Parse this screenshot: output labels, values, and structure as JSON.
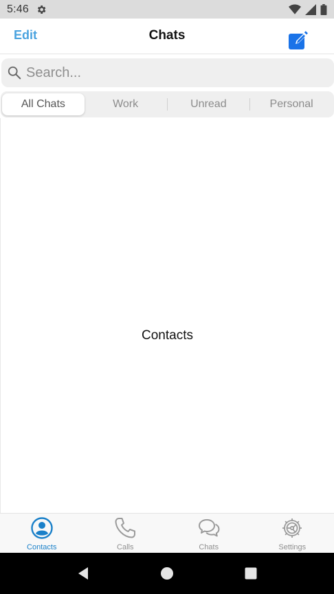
{
  "status_bar": {
    "time": "5:46",
    "icons": [
      "gear-icon",
      "wifi-icon",
      "signal-icon",
      "battery-icon"
    ]
  },
  "header": {
    "edit_label": "Edit",
    "title": "Chats",
    "compose_icon": "compose-icon"
  },
  "search": {
    "placeholder": "Search...",
    "value": ""
  },
  "tabs": [
    {
      "label": "All Chats",
      "active": true
    },
    {
      "label": "Work",
      "active": false
    },
    {
      "label": "Unread",
      "active": false
    },
    {
      "label": "Personal",
      "active": false
    }
  ],
  "main": {
    "label": "Contacts"
  },
  "tabbar": {
    "items": [
      {
        "label": "Contacts",
        "icon": "contacts-icon",
        "active": true
      },
      {
        "label": "Calls",
        "icon": "phone-icon",
        "active": false
      },
      {
        "label": "Chats",
        "icon": "chat-bubbles-icon",
        "active": false
      },
      {
        "label": "Settings",
        "icon": "gear-icon",
        "active": false
      }
    ]
  },
  "navbar": {
    "icons": [
      "back-icon",
      "home-icon",
      "recents-icon"
    ]
  },
  "colors": {
    "accent": "#1a80c9",
    "edit": "#4aa3df",
    "compose": "#1a73e8",
    "inactive_icon": "#9a9a9a"
  }
}
